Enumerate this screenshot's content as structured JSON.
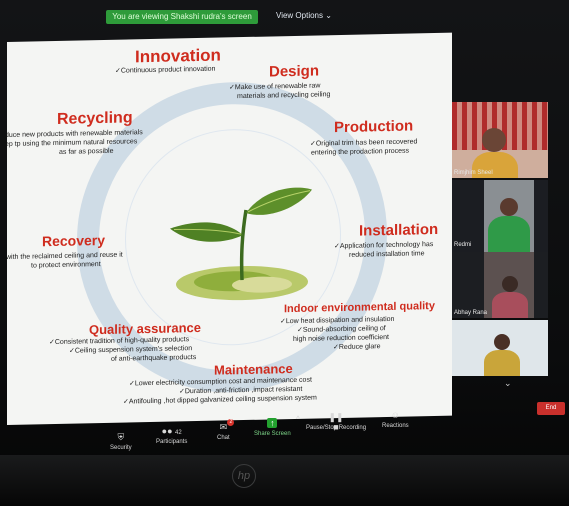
{
  "screen_share": {
    "banner": "You are viewing Shakshi rudra's screen",
    "view_options": "View Options ⌄"
  },
  "slide": {
    "innovation": {
      "title": "Innovation",
      "lines": [
        "✓Continuous product innovation"
      ]
    },
    "design": {
      "title": "Design",
      "lines": [
        "✓Make use of renewable raw",
        "materials and recycling ceiling"
      ]
    },
    "recycling": {
      "title": "Recycling",
      "lines": [
        "duce new products with renewable materials",
        "ep tp using the minimum natural resources",
        "as far as possible"
      ]
    },
    "production": {
      "title": "Production",
      "lines": [
        "✓Original trim has been recovered",
        "entering the prodaction process"
      ]
    },
    "installation": {
      "title": "Installation",
      "lines": [
        "✓Application for technology has",
        "reduced installation time"
      ]
    },
    "recovery": {
      "title": "Recovery",
      "lines": [
        "with the reclaimed ceiling and reuse it",
        "to protect environment"
      ]
    },
    "indoor": {
      "title": "Indoor environmental quality",
      "lines": [
        "✓Low heat dissipation and insulation",
        "✓Sound-absorbing ceiling of",
        "high noise reduction coefficient",
        "✓Reduce glare"
      ]
    },
    "quality": {
      "title": "Quality assurance",
      "lines": [
        "✓Consistent tradition of high-quality products",
        "✓Ceiling suspension system's selection",
        "of anti-earthquake products"
      ]
    },
    "maintenance": {
      "title": "Maintenance",
      "lines": [
        "✓Lower electricity consumption cost and maintenance cost",
        "✓Duration ,anti-friction ,impact resistant",
        "✓Antifouling ,hot dipped galvanized ceiling suspension system"
      ]
    }
  },
  "participants": [
    {
      "name": "Rimjhim Sheel"
    },
    {
      "name": "Redmi"
    },
    {
      "name": "Abhay Rana"
    },
    {
      "name": ""
    }
  ],
  "toolbar": {
    "security": "Security",
    "participants": "Participants",
    "participants_count": "42",
    "chat": "Chat",
    "chat_badge": "2",
    "share_screen": "Share Screen",
    "recording": "Pause/Stop Recording",
    "reactions": "Reactions",
    "end": "End"
  },
  "colors": {
    "heading": "#cf2c1e",
    "share_green": "#23a12f",
    "end_red": "#c9302c"
  }
}
